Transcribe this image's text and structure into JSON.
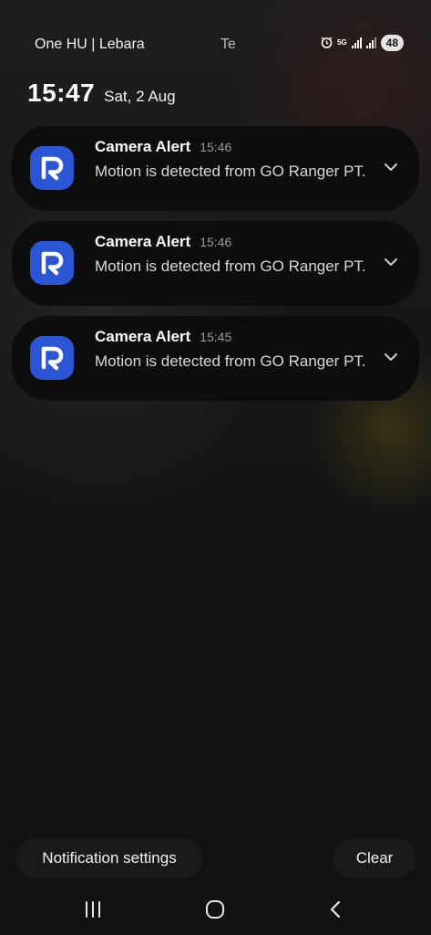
{
  "status_bar": {
    "carrier": "One HU | Lebara",
    "center_text": "Te",
    "network_label": "5G",
    "battery": "48",
    "icons": [
      "alarm-icon",
      "5g-icon",
      "signal-icon",
      "signal-icon",
      "battery-icon"
    ]
  },
  "lockscreen": {
    "time": "15:47",
    "date": "Sat, 2 Aug"
  },
  "notifications": [
    {
      "app_icon": "r-logo-icon",
      "title": "Camera Alert",
      "time": "15:46",
      "body": "Motion is detected from GO Ranger PT."
    },
    {
      "app_icon": "r-logo-icon",
      "title": "Camera Alert",
      "time": "15:46",
      "body": "Motion is detected from GO Ranger PT."
    },
    {
      "app_icon": "r-logo-icon",
      "title": "Camera Alert",
      "time": "15:45",
      "body": "Motion is detected from GO Ranger PT."
    }
  ],
  "actions": {
    "settings_label": "Notification settings",
    "clear_label": "Clear"
  },
  "nav_bar": {
    "icons": [
      "recents-icon",
      "home-icon",
      "back-icon"
    ]
  },
  "colors": {
    "app_icon_bg": "#2a56d6",
    "card_bg": "#0d0d0d",
    "button_bg": "#1a1a1a"
  }
}
